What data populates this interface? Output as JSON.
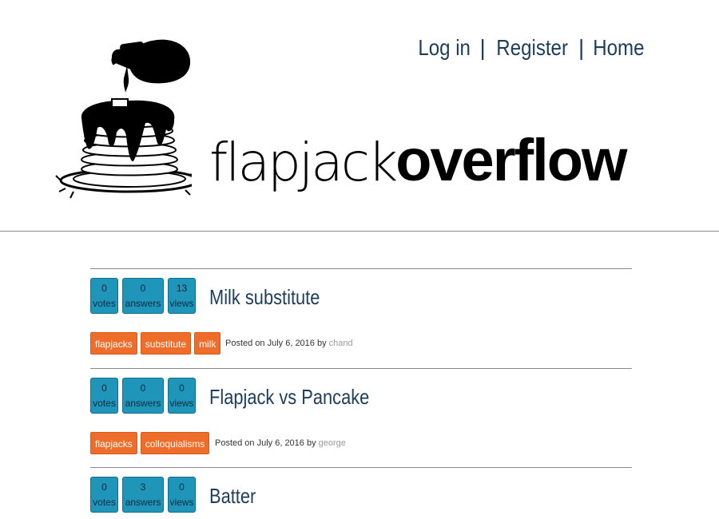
{
  "nav": {
    "login": "Log in",
    "register": "Register",
    "home": "Home",
    "separator": "|"
  },
  "brand": {
    "light": "flapjack",
    "bold": "overflow"
  },
  "questions": [
    {
      "votes": "0",
      "votes_label": "votes",
      "answers": "0",
      "answers_label": "answers",
      "views": "13",
      "views_label": "views",
      "title": "Milk substitute",
      "tags": [
        "flapjacks",
        "substitute",
        "milk"
      ],
      "posted_prefix": "Posted on July 6, 2016 by",
      "author": "chand"
    },
    {
      "votes": "0",
      "votes_label": "votes",
      "answers": "0",
      "answers_label": "answers",
      "views": "0",
      "views_label": "views",
      "title": "Flapjack vs Pancake",
      "tags": [
        "flapjacks",
        "colloquialisms"
      ],
      "posted_prefix": "Posted on July 6, 2016 by",
      "author": "george"
    },
    {
      "votes": "0",
      "votes_label": "votes",
      "answers": "3",
      "answers_label": "answers",
      "views": "0",
      "views_label": "views",
      "title": "Batter"
    }
  ],
  "colors": {
    "stat_blue": "#1f95b9",
    "tag_orange": "#ef6d2a",
    "link_navy": "#1d3d5c"
  }
}
